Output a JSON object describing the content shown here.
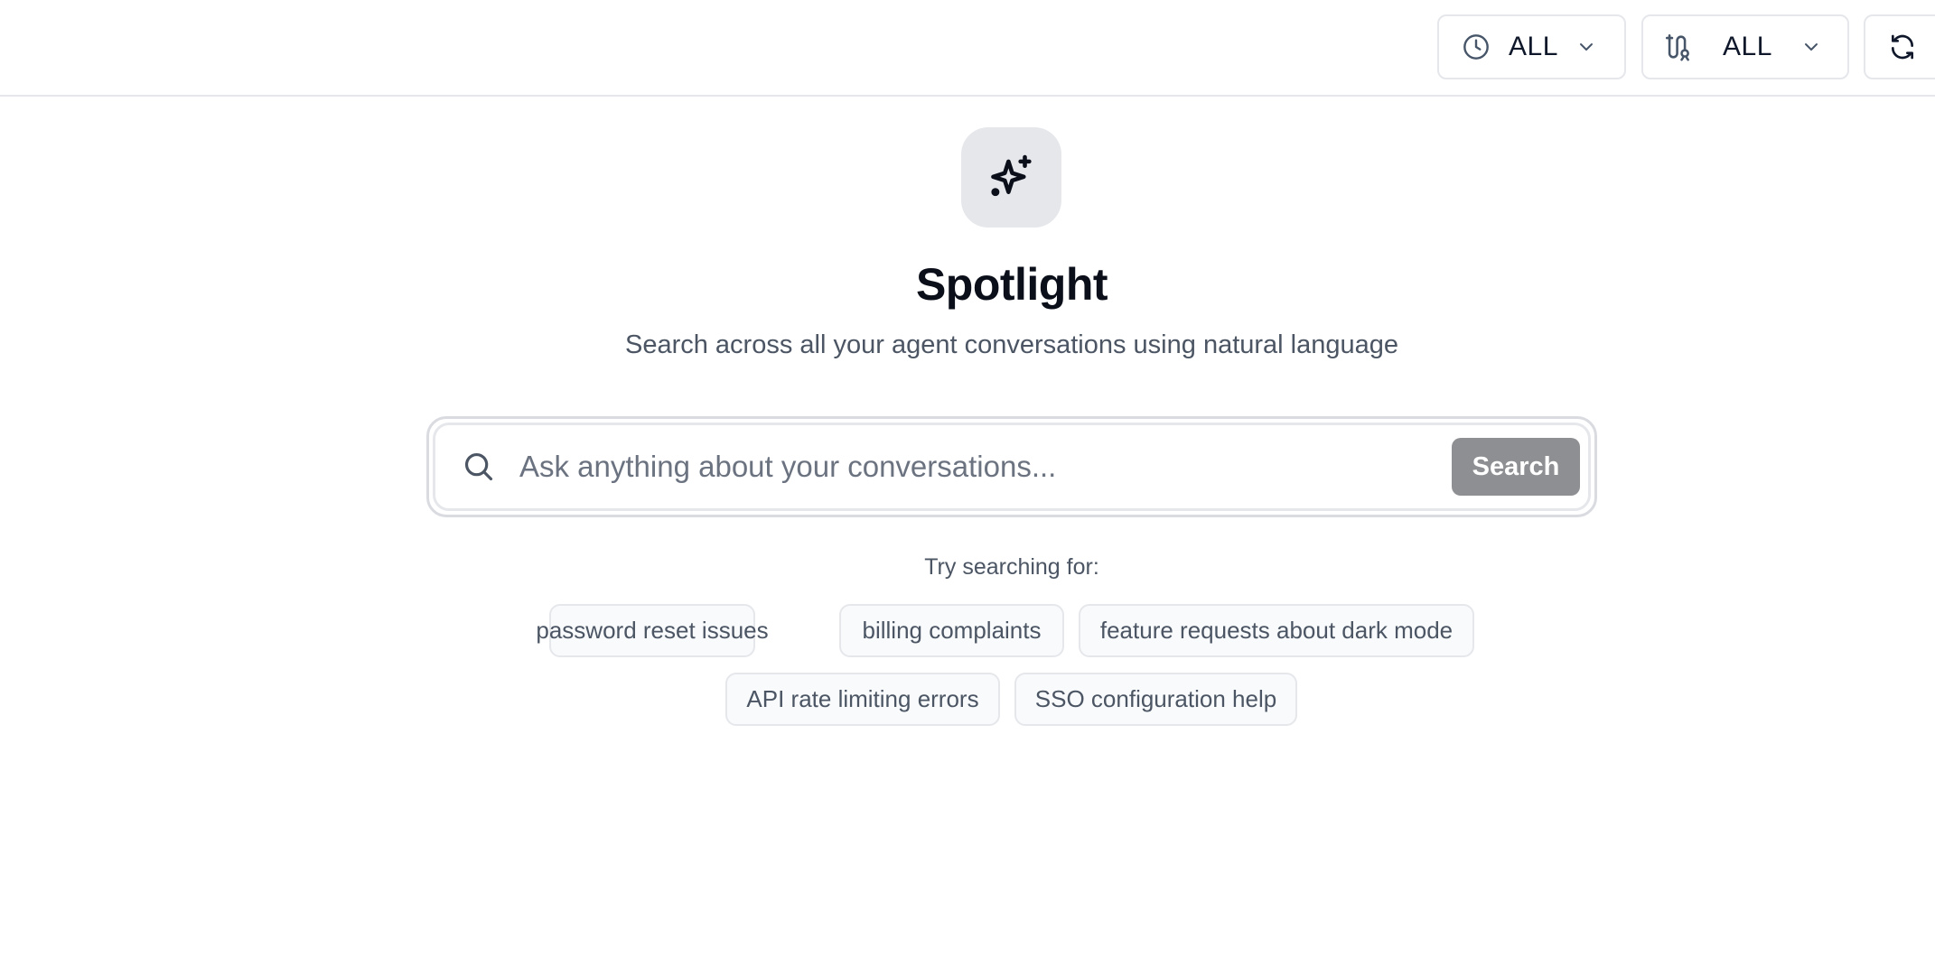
{
  "toolbar": {
    "time_filter": {
      "value": "ALL",
      "icon": "clock-icon"
    },
    "agent_filter": {
      "value": "ALL",
      "icon": "agent-route-icon"
    },
    "refresh": {
      "icon": "refresh-icon"
    }
  },
  "hero": {
    "icon": "sparkles-icon",
    "title": "Spotlight",
    "subtitle": "Search across all your agent conversations using natural language"
  },
  "search": {
    "placeholder": "Ask anything about your conversations...",
    "value": "",
    "button_label": "Search",
    "button_color": "#8e8f92"
  },
  "suggestions": {
    "label": "Try searching for:",
    "items": [
      "password reset issues",
      "billing complaints",
      "feature requests about dark mode",
      "API rate limiting errors",
      "SSO configuration help"
    ]
  }
}
